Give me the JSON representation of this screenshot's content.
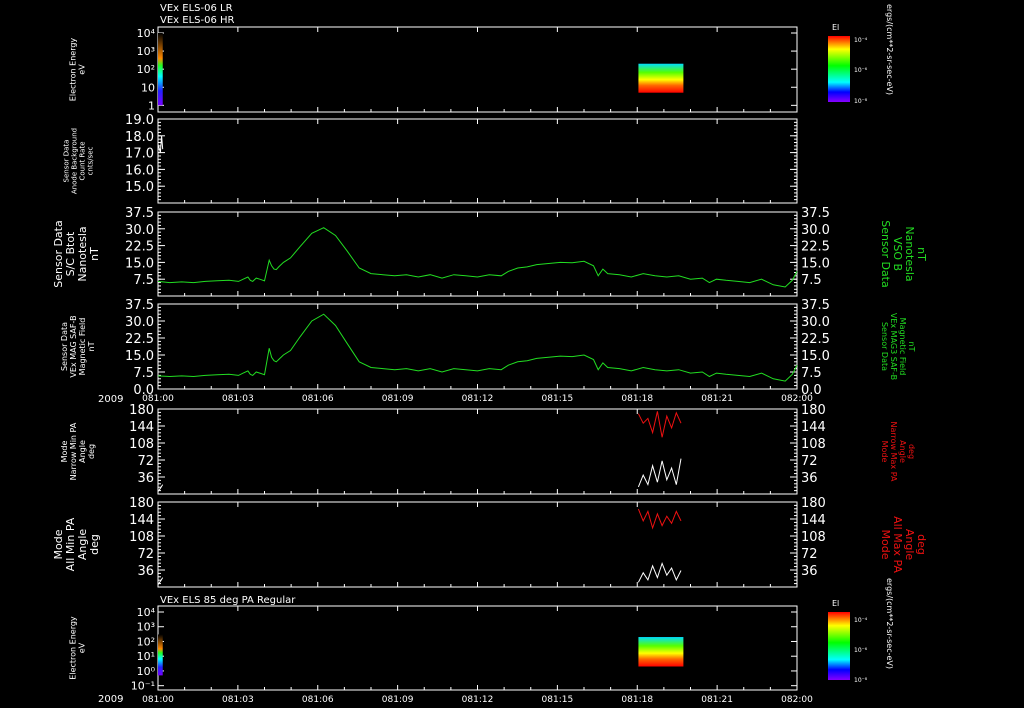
{
  "header": {
    "line1": "VEx ELS-06 LR",
    "line2": "VEx ELS-06 HR"
  },
  "bottom_title": "VEx ELS 85 deg PA Regular",
  "year": "2009",
  "colors": {
    "green": "#22dd22",
    "red": "#ee1111",
    "white": "#ffffff",
    "axis": "#ffffff"
  },
  "colorbar": {
    "title": "El",
    "unit": "ergs/(cm**2-sr-sec-eV)",
    "ticks_top": [
      "10⁻⁴",
      "10⁻⁶",
      "10⁻⁸"
    ],
    "ticks_bottom": [
      "10⁻⁴",
      "10⁻⁶",
      "10⁻⁸"
    ]
  },
  "chart_data": [
    {
      "type": "heatmap",
      "id": "els-lr-hr",
      "ylabel": [
        "Electron Energy",
        "eV"
      ],
      "yscale": "log",
      "yticks": [
        "10⁴",
        "10³",
        "10²",
        "10",
        "1"
      ],
      "xticks": [
        "081:00",
        "081:03",
        "081:06",
        "081:09",
        "081:12",
        "081:15",
        "081:18",
        "081:21",
        "082:00"
      ],
      "data_blocks": [
        {
          "t_start": "081:00",
          "t_end": "081:00.2",
          "e_min": 1,
          "e_max": 10000
        },
        {
          "t_start": "081:20.3",
          "t_end": "081:22.2",
          "e_min": 5,
          "e_max": 200
        }
      ]
    },
    {
      "type": "line",
      "id": "background",
      "ylabel": [
        "Sensor Data",
        "Anode Background",
        "Count Rate",
        "cnts/sec"
      ],
      "yticks": [
        19.0,
        18.0,
        17.0,
        16.0,
        15.0
      ],
      "ylim": [
        14.0,
        19.0
      ],
      "series": [
        {
          "color": "#ffffff",
          "x": [
            0.0,
            0.1,
            0.15,
            0.2
          ],
          "y": [
            17.5,
            17.0,
            18.0,
            17.2
          ]
        }
      ]
    },
    {
      "type": "line",
      "id": "btot",
      "ylabel": [
        "Sensor Data",
        "S/C Btot",
        "Nanotesla",
        "nT"
      ],
      "ylabel_right": [
        "Sensor Data",
        "VSO B",
        "Nanotesla",
        "nT"
      ],
      "yticks": [
        37.5,
        30.0,
        22.5,
        15.0,
        7.5
      ],
      "ylim": [
        0,
        37.5
      ],
      "series": [
        {
          "color": "#22dd22",
          "x": [
            0,
            0.5,
            1,
            1.5,
            2,
            2.5,
            3,
            3.4,
            3.6,
            3.8,
            3.9,
            4.0,
            4.15,
            4.3,
            4.5,
            4.7,
            4.8,
            4.9,
            5.0,
            5.1,
            5.3,
            5.6,
            6,
            6.5,
            7,
            7.5,
            8,
            8.5,
            9,
            9.5,
            10,
            10.5,
            11,
            11.5,
            12,
            12.5,
            13,
            13.5,
            14,
            14.5,
            14.8,
            15.2,
            15.6,
            16,
            16.5,
            17,
            17.5,
            18,
            18.4,
            18.6,
            18.8,
            19,
            19.5,
            20,
            20.5,
            21,
            21.5,
            22,
            22.5,
            23,
            23.3,
            23.6,
            24,
            24.5,
            25,
            25.5,
            26,
            26.5,
            26.8,
            27
          ],
          "y": [
            6.5,
            6.0,
            6.3,
            6.0,
            6.5,
            6.8,
            7.0,
            6.5,
            7.5,
            8.5,
            7.0,
            6.5,
            8.0,
            7.5,
            6.8,
            16.0,
            13.5,
            12.0,
            11.8,
            13.0,
            15.0,
            17.0,
            22.0,
            28.0,
            30.5,
            27.0,
            20.0,
            12.5,
            10.0,
            9.5,
            9.0,
            9.5,
            8.5,
            9.5,
            8.0,
            9.5,
            9.0,
            8.5,
            9.5,
            9.0,
            11.0,
            12.5,
            13.0,
            14.0,
            14.5,
            15.0,
            14.8,
            15.5,
            13.5,
            9.0,
            12.0,
            10.0,
            9.5,
            8.5,
            10.0,
            9.0,
            8.5,
            9.0,
            7.5,
            8.0,
            6.0,
            7.5,
            7.0,
            6.5,
            6.0,
            7.5,
            5.0,
            4.0,
            7.0,
            11.0
          ]
        }
      ]
    },
    {
      "type": "line",
      "id": "mag",
      "ylabel": [
        "Sensor Data",
        "VEx MAG SAF-B",
        "Magnetic Field",
        "nT"
      ],
      "ylabel_right": [
        "Sensor Data",
        "VEx MAG3 SAF-B",
        "Magnetic Field",
        "nT"
      ],
      "yticks": [
        37.5,
        30.0,
        22.5,
        15.0,
        7.5,
        0.0
      ],
      "ylim": [
        0,
        37.5
      ],
      "series": [
        {
          "color": "#22dd22",
          "x": [
            0,
            0.5,
            1,
            1.5,
            2,
            2.5,
            3,
            3.4,
            3.6,
            3.8,
            3.9,
            4.0,
            4.15,
            4.3,
            4.5,
            4.7,
            4.8,
            4.9,
            5.0,
            5.1,
            5.3,
            5.6,
            6,
            6.5,
            7,
            7.5,
            8,
            8.5,
            9,
            9.5,
            10,
            10.5,
            11,
            11.5,
            12,
            12.5,
            13,
            13.5,
            14,
            14.5,
            14.8,
            15.2,
            15.6,
            16,
            16.5,
            17,
            17.5,
            18,
            18.4,
            18.6,
            18.8,
            19,
            19.5,
            20,
            20.5,
            21,
            21.5,
            22,
            22.5,
            23,
            23.3,
            23.6,
            24,
            24.5,
            25,
            25.5,
            26,
            26.5,
            26.8,
            27
          ],
          "y": [
            5.8,
            5.5,
            5.8,
            5.5,
            6.0,
            6.3,
            6.5,
            6.0,
            7.0,
            8.0,
            6.5,
            6.0,
            7.5,
            7.0,
            6.3,
            18.0,
            14.0,
            12.5,
            12.0,
            13.0,
            15.0,
            17.0,
            23.0,
            30.0,
            33.0,
            28.0,
            20.0,
            12.0,
            9.5,
            9.0,
            8.5,
            9.0,
            8.0,
            9.0,
            7.5,
            9.0,
            8.5,
            8.0,
            9.0,
            8.5,
            10.5,
            12.0,
            12.5,
            13.5,
            14.0,
            14.5,
            14.3,
            15.0,
            13.0,
            8.5,
            11.5,
            9.5,
            9.0,
            8.0,
            9.5,
            8.5,
            8.0,
            8.5,
            7.0,
            7.5,
            5.5,
            7.0,
            6.5,
            6.0,
            5.5,
            7.0,
            4.5,
            3.5,
            6.5,
            10.5
          ]
        }
      ]
    },
    {
      "type": "line",
      "id": "narrow-pa",
      "ylabel": [
        "Mode",
        "Narrow Min PA",
        "Angle",
        "deg"
      ],
      "ylabel_right": [
        "Mode",
        "Narrow Max PA",
        "Angle",
        "deg"
      ],
      "yticks": [
        180,
        144,
        108,
        72,
        36
      ],
      "ylim": [
        0,
        180
      ],
      "series": [
        {
          "color": "#ffffff",
          "x": [
            0.0,
            0.1,
            0.2
          ],
          "y": [
            5,
            12,
            20
          ]
        },
        {
          "color": "#ee1111",
          "x": [
            20.3,
            20.5,
            20.7,
            20.9,
            21.1,
            21.3,
            21.5,
            21.7,
            21.9,
            22.1
          ],
          "y": [
            170,
            150,
            160,
            130,
            175,
            120,
            165,
            140,
            172,
            150
          ]
        },
        {
          "color": "#ffffff",
          "x": [
            20.3,
            20.5,
            20.7,
            20.9,
            21.1,
            21.3,
            21.5,
            21.7,
            21.9,
            22.1
          ],
          "y": [
            15,
            40,
            20,
            60,
            25,
            70,
            30,
            55,
            20,
            75
          ]
        }
      ]
    },
    {
      "type": "line",
      "id": "all-pa",
      "ylabel": [
        "Mode",
        "All Min PA",
        "Angle",
        "deg"
      ],
      "ylabel_right": [
        "Mode",
        "All Max PA",
        "Angle",
        "deg"
      ],
      "yticks": [
        180,
        144,
        108,
        72,
        36
      ],
      "ylim": [
        0,
        180
      ],
      "series": [
        {
          "color": "#ffffff",
          "x": [
            0.0,
            0.1,
            0.2
          ],
          "y": [
            5,
            12,
            20
          ]
        },
        {
          "color": "#ee1111",
          "x": [
            20.3,
            20.5,
            20.7,
            20.9,
            21.1,
            21.3,
            21.5,
            21.7,
            21.9,
            22.1
          ],
          "y": [
            165,
            140,
            160,
            125,
            155,
            130,
            150,
            135,
            160,
            140
          ]
        },
        {
          "color": "#ffffff",
          "x": [
            20.3,
            20.5,
            20.7,
            20.9,
            21.1,
            21.3,
            21.5,
            21.7,
            21.9,
            22.1
          ],
          "y": [
            10,
            30,
            15,
            45,
            20,
            50,
            25,
            40,
            15,
            35
          ]
        }
      ]
    },
    {
      "type": "heatmap",
      "id": "els-85pa",
      "ylabel": [
        "Electron Energy",
        "eV"
      ],
      "yscale": "log",
      "yticks": [
        "10⁴",
        "10³",
        "10²",
        "10¹",
        "10⁰",
        "10⁻¹"
      ],
      "xticks": [
        "081:00",
        "081:03",
        "081:06",
        "081:09",
        "081:12",
        "081:15",
        "081:18",
        "081:21",
        "082:00"
      ],
      "data_blocks": [
        {
          "t_start": "081:00",
          "t_end": "081:00.2",
          "e_min": 0.5,
          "e_max": 300
        },
        {
          "t_start": "081:20.3",
          "t_end": "081:22.2",
          "e_min": 2,
          "e_max": 200
        }
      ]
    }
  ]
}
